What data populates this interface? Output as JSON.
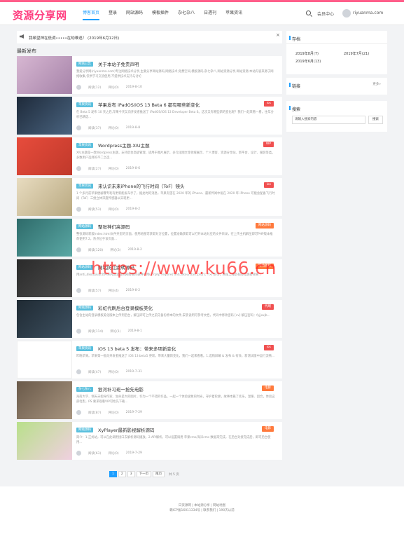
{
  "site": {
    "logo": "资源分享网"
  },
  "nav": [
    {
      "label": "博客首页"
    },
    {
      "label": "登录"
    },
    {
      "label": "网站源码"
    },
    {
      "label": "模板插件"
    },
    {
      "label": "杂七杂八"
    },
    {
      "label": "日週刊"
    },
    {
      "label": "苹果资讯"
    }
  ],
  "header": {
    "member": "会员中心",
    "site_domain": "riyuanma.com"
  },
  "notice": {
    "text": "我希望神在低调•••••在劫难逃！ (2019年6月12日)",
    "close": "×"
  },
  "section_title": "最新发布",
  "posts": [
    {
      "cat": "网站公告",
      "title": "关于本站子免责声明",
      "tag": "",
      "excerpt": "我爱分享网(riyuanma.com)专注网络技术分享,主要分享网站源码,网络技术,免费空间,模板源码,杂七杂八,网站资源分享,网站资源,本站内容来源于网络收集,仅供学习交流使用,不提供技术支持与讨论",
      "views": "阅读(12)",
      "comments": "评论(0)",
      "date": "2019-8-10",
      "thumb_color": "#c8a0c0"
    },
    {
      "cat": "苹果资讯",
      "title": "苹果发布 iPadOS/iOS 13 Beta 6 都有哪些新变化",
      "tag": "ios",
      "excerpt": "在 Beta 5 发布 10 天之后,苹果今天又向开发者推送了 iPadOS/iOS 13 Developer Beta 6。这次又有哪些新的变化呢？我们一起来看一看。往年分析已精选...",
      "views": "阅读(37)",
      "comments": "评论(0)",
      "date": "2019-8-8",
      "thumb_color": "#2d3a4a"
    },
    {
      "cat": "苹果资讯",
      "title": "Wordpress主题-XIU主题",
      "tag": "WP",
      "excerpt": "XIU主题是一款Wordpress主题，支持后台高级管理，适用于图片展示、多元化图文等领域展示、个人博客、资源分享站、新平台、设计、服装等类，多数用户选择的不二之选...",
      "views": "阅读(27)",
      "comments": "评论(0)",
      "date": "2019-8-6",
      "thumb_color": "#e74c3c"
    },
    {
      "cat": "苹果资讯",
      "title": "来认识未来iPhone的飞行时间（ToF）镜头",
      "tag": "ios",
      "excerpt": "1 个多月前苹果便被曝专利有更新能发布手了，据此时的消息，苹果有望在 2020 年的 iPhone、最新传闻中说在 2020 年 iPhone 可能会配备飞行时间（ToF）三维立体深度传感器以实现更...",
      "views": "阅读(53)",
      "comments": "评论(0)",
      "date": "2019-8-2",
      "thumb_color": "#d8c9a0"
    },
    {
      "cat": "网站源码",
      "title": "整张神们高源码",
      "tag": "网站源码",
      "excerpt": "整张源码新版index.html文件夹里的页面，使用地图可获取对方位置，位置准确获取可以打开本站对应的文件目录，在上传主机解压即可PHP版本推荐使用7.2，热点位于该页面...",
      "views": "阅读(120)",
      "comments": "评论(3)",
      "date": "2019-8-2",
      "thumb_color": "#3a8c8a"
    },
    {
      "cat": "网站源码",
      "title": "网站防红跳转源码",
      "tag": "网站源码",
      "excerpt": "用anti_dkou/jiuyi文件夹内容里放到网站根目录并引用(<?php require('anti_dkou/start.php'); ?>) 即可，网站上线后有防红跳转效果...",
      "views": "阅读(57)",
      "comments": "评论(4)",
      "date": "2019-8-2",
      "thumb_color": "#3a3a3a"
    },
    {
      "cat": "网站源码",
      "title": "彩虹代刷后台登录模板美化",
      "tag": "代刷",
      "excerpt": "包含主站的登录模板美化版本上传到后台，解压即可上传之前先备份原本的文件,安装说明可参考文档，代码中修改密码 [cv] 解压密码：fyjjxxjb...",
      "views": "阅读(114)",
      "comments": "评论(1)",
      "date": "2019-8-1",
      "thumb_color": "#2a3540"
    },
    {
      "cat": "苹果资讯",
      "title": "iOS 13 beta 5 发布：带来多项新变化",
      "tag": "ios",
      "excerpt": "昨晚苹果。苹果第一批向开发者推送了 iOS 13 beta5 更新，带来大量新变化，我们一起来看看。1.选购屏幕 & 发布 & 有效、新测试版中运行流畅...",
      "views": "阅读(47)",
      "comments": "评论(0)",
      "date": "2019-7-31",
      "thumb_color": "#ffffff"
    },
    {
      "cat": "杂七杂八",
      "title": "狠河补习班一抢先电影",
      "tag": "电影",
      "excerpt": "海南大学、侧天天指导作家、生命是大的图片，作为一个不错的作品。一起一个体验极致的时光，守护着轮廓，故事本篇了欢乐，温暖、因合，体验这部电影，PS 要求观看VIP可抢先下载...",
      "views": "阅读(87)",
      "comments": "评论(0)",
      "date": "2019-7-29",
      "thumb_color": "#8a7a6a"
    },
    {
      "cat": "网站源码",
      "title": "XyPlayer最新影视解析源码",
      "tag": "电影",
      "excerpt": "简介：1.正式站，可以在此调用接口去解析源码播放。2.API解析，可以设置调用 苹果cms/海洋cms 数据来完成，在后台对接完成后，即可后台使用...",
      "views": "阅读(63)",
      "comments": "评论(0)",
      "date": "2019-7-29",
      "thumb_color": "#8fcf6a"
    }
  ],
  "pagination": {
    "pages": [
      "1",
      "2",
      "3"
    ],
    "next": "下一页",
    "last": "尾页",
    "total": "共 5 页"
  },
  "sidebar": {
    "archive_title": "存档",
    "archives": [
      "2019年8月(7)",
      "2019年7月(21)",
      "2019年6月(13)"
    ],
    "links_title": "链接",
    "links_more": "更多»",
    "search_title": "搜索",
    "search_placeholder": "请输入搜索内容",
    "search_btn": "搜索"
  },
  "footer": {
    "line1": "日资源网 | 本站源分享 | 网站地图",
    "line2": "赣ICP备16011334号 | 联系我们 | 190天以前"
  },
  "watermark": "https://www.ku66.cn"
}
